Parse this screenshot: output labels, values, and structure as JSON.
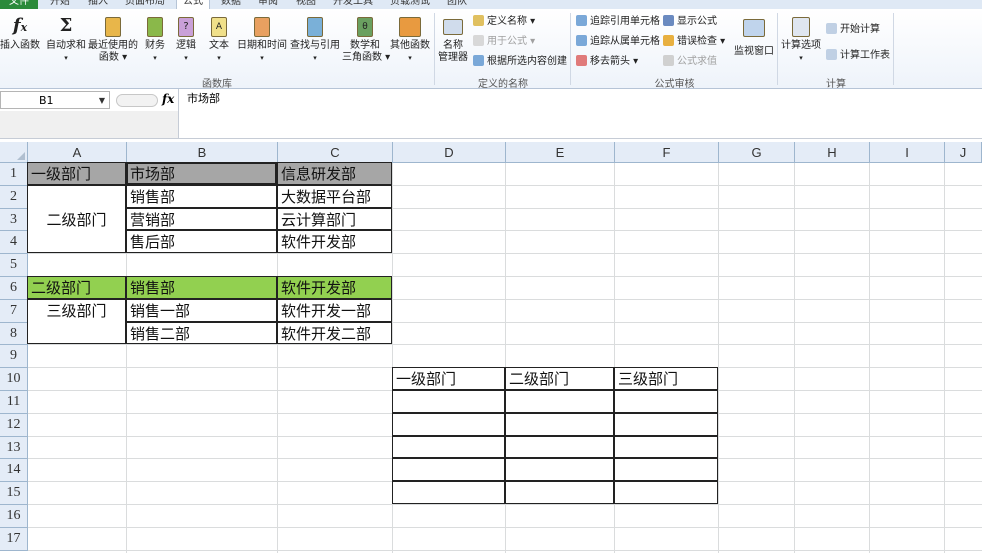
{
  "tabs": [
    "文件",
    "开始",
    "插入",
    "页面布局",
    "公式",
    "数据",
    "审阅",
    "视图",
    "开发工具",
    "负载测试",
    "团队"
  ],
  "active_tab": "公式",
  "ribbon": {
    "library": {
      "title": "函数库",
      "insert_function": "插入函数",
      "autosum": "自动求和",
      "recent": "最近使用的",
      "recent2": "函数",
      "finance": "财务",
      "logic": "逻辑",
      "text": "文本",
      "datetime": "日期和时间",
      "lookup": "查找与引用",
      "math": "数学和",
      "math2": "三角函数",
      "other": "其他函数"
    },
    "names": {
      "title": "定义的名称",
      "manager": "名称",
      "manager2": "管理器",
      "define": "定义名称",
      "use_in_formula": "用于公式",
      "create_from_selection": "根据所选内容创建"
    },
    "audit": {
      "title": "公式审核",
      "trace_precedents": "追踪引用单元格",
      "trace_dependents": "追踪从属单元格",
      "remove_arrows": "移去箭头",
      "show_formulas": "显示公式",
      "error_check": "错误检查",
      "evaluate": "公式求值",
      "watch": "监视窗口"
    },
    "calc": {
      "title": "计算",
      "options": "计算选项",
      "calc_now": "开始计算",
      "calc_sheet": "计算工作表"
    }
  },
  "formula_bar": {
    "name_box": "B1",
    "fx": "fx",
    "content": "市场部"
  },
  "columns": [
    "A",
    "B",
    "C",
    "D",
    "E",
    "F",
    "G",
    "H",
    "I",
    "J"
  ],
  "rows": [
    "1",
    "2",
    "3",
    "4",
    "5",
    "6",
    "7",
    "8",
    "9",
    "10",
    "11",
    "12",
    "13",
    "14",
    "15",
    "16",
    "17"
  ],
  "cells": {
    "A1": "一级部门",
    "B1": "市场部",
    "C1": "信息研发部",
    "A2": "二级部门",
    "B2": "销售部",
    "C2": "大数据平台部",
    "B3": "营销部",
    "C3": "云计算部门",
    "B4": "售后部",
    "C4": "软件开发部",
    "A6": "二级部门",
    "B6": "销售部",
    "C6": "软件开发部",
    "A7": "三级部门",
    "B7": "销售一部",
    "C7": "软件开发一部",
    "B8": "销售二部",
    "C8": "软件开发二部",
    "D10": "一级部门",
    "E10": "二级部门",
    "F10": "三级部门"
  },
  "colors": {
    "header_gray": "#a6a6a6",
    "header_green": "#92d050",
    "file_tab": "#2a8a3a"
  }
}
